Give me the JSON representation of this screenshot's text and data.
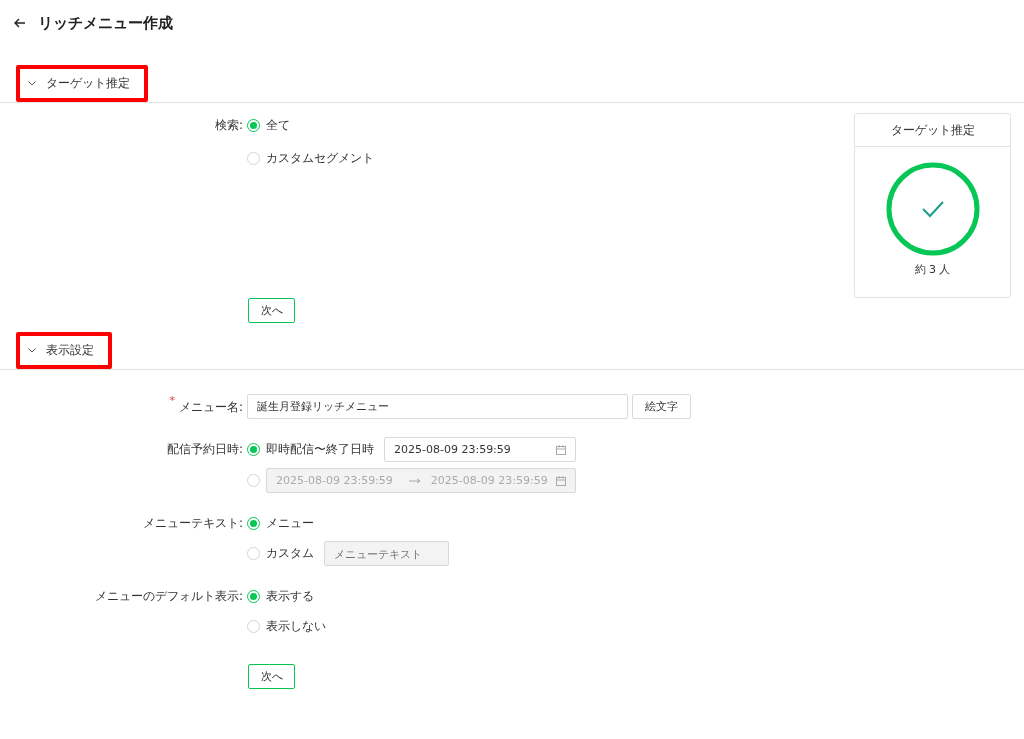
{
  "page": {
    "title": "リッチメニュー作成"
  },
  "sections": [
    {
      "title": "ターゲット推定",
      "expanded": true,
      "highlighted": true,
      "fields": [
        {
          "kind": "radio",
          "label": "検索:",
          "options": [
            {
              "label": "全て",
              "selected": true
            },
            {
              "label": "カスタムセグメント",
              "selected": false
            }
          ]
        }
      ],
      "estimate": {
        "title": "ターゲット推定",
        "count": "約 3 人"
      },
      "next_button": "次へ"
    },
    {
      "title": "表示設定",
      "expanded": true,
      "highlighted": true,
      "fields": [
        {
          "kind": "text",
          "label": "メニュー名:",
          "required_mark": "*",
          "value": "誕生月登録リッチメニュー",
          "button": "絵文字"
        },
        {
          "kind": "radio",
          "label": "配信予約日時:",
          "options": [
            {
              "label": "即時配信〜終了日時",
              "selected": true,
              "date": "2025-08-09 23:59:59"
            },
            {
              "selected": false,
              "range": {
                "start": "2025-08-09 23:59:59",
                "end": "2025-08-09 23:59:59"
              }
            }
          ]
        },
        {
          "kind": "radio",
          "label": "メニューテキスト:",
          "options": [
            {
              "label": "メニュー",
              "selected": true
            },
            {
              "label": "カスタム",
              "selected": false,
              "placeholder": "メニューテキスト"
            }
          ]
        },
        {
          "kind": "radio",
          "label": "メニューのデフォルト表示:",
          "options": [
            {
              "label": "表示する",
              "selected": true
            },
            {
              "label": "表示しない",
              "selected": false
            }
          ]
        }
      ],
      "next_button": "次へ"
    }
  ]
}
